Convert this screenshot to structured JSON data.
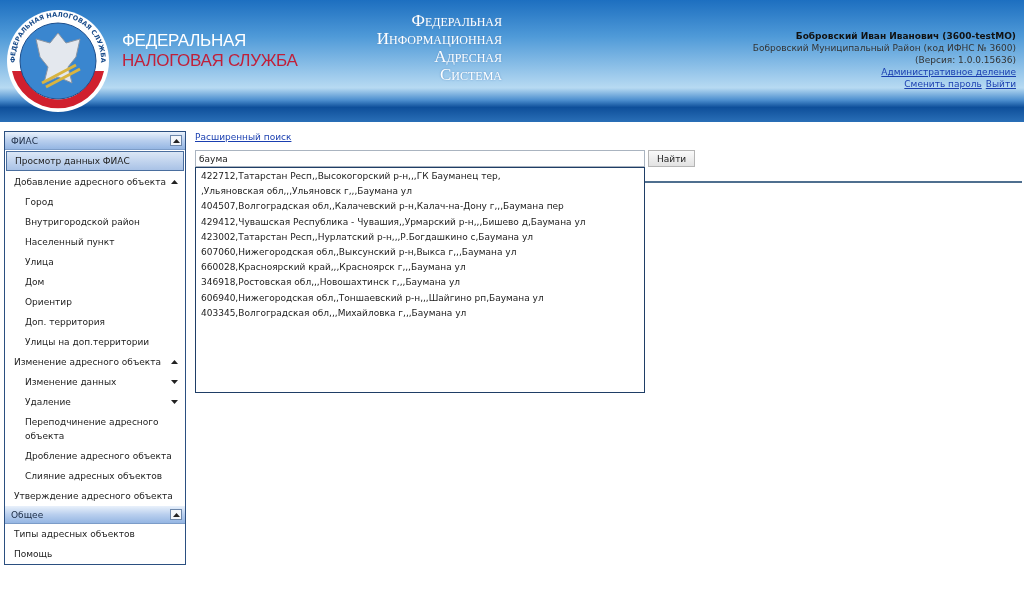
{
  "header": {
    "logo": {
      "ring_text": "ФЕДЕРАЛЬНАЯ НАЛОГОВАЯ СЛУЖБА"
    },
    "service_name": [
      "ФЕДЕРАЛЬНАЯ",
      "НАЛОГОВАЯ СЛУЖБА"
    ],
    "system_name": [
      "Федеральная",
      "Информационная",
      "Адресная",
      "Система"
    ],
    "user": {
      "name": "Бобровский Иван Иванович (3600-testMO)",
      "district": "Бобровский Муниципальный Район (код ИФНС № 3600)",
      "version": "(Версия: 1.0.0.15636)",
      "links": [
        [
          "Административное деление"
        ],
        [
          "Сменить пароль",
          "Выйти"
        ]
      ]
    }
  },
  "sidebar": {
    "sections": [
      {
        "title": "ФИАС",
        "expanded": true,
        "items": [
          {
            "label": "Просмотр данных ФИАС",
            "selected": true
          },
          {
            "label": "Добавление адресного объекта",
            "selected": false,
            "expanded": true,
            "children": [
              {
                "label": "Город",
                "selected": false
              },
              {
                "label": "Внутригородской район",
                "selected": false
              },
              {
                "label": "Населенный пункт",
                "selected": false
              },
              {
                "label": "Улица",
                "selected": false
              },
              {
                "label": "Дом",
                "selected": false
              },
              {
                "label": "Ориентир",
                "selected": false
              },
              {
                "label": "Доп. территория",
                "selected": false
              },
              {
                "label": "Улицы на доп.территории",
                "selected": false
              }
            ]
          },
          {
            "label": "Изменение адресного объекта",
            "selected": false,
            "expanded": true,
            "children": [
              {
                "label": "Изменение данных",
                "selected": false,
                "expanded": false
              },
              {
                "label": "Удаление",
                "selected": false,
                "expanded": false
              },
              {
                "label": "Переподчинение адресного объекта",
                "selected": false
              },
              {
                "label": "Дробление адресного объекта",
                "selected": false
              },
              {
                "label": "Слияние адресных объектов",
                "selected": false
              }
            ]
          },
          {
            "label": "Утверждение адресного объекта",
            "selected": false
          }
        ]
      },
      {
        "title": "Общее",
        "expanded": true,
        "items": [
          {
            "label": "Типы адресных объектов",
            "selected": false
          },
          {
            "label": "Помощь",
            "selected": false
          }
        ]
      }
    ]
  },
  "search": {
    "advanced_link": "Расширенный поиск",
    "value": "баума",
    "button": "Найти",
    "suggestions": [
      "422712,Татарстан Респ,,Высокогорский р-н,,,ГК Бауманец тер,",
      ",Ульяновская обл,,,Ульяновск г,,,Баумана ул",
      "404507,Волгоградская обл,,Калачевский р-н,Калач-на-Дону г,,,Баумана пер",
      "429412,Чувашская Республика - Чувашия,,Урмарский р-н,,,Бишево д,Баумана ул",
      "423002,Татарстан Респ,,Нурлатский р-н,,,Р.Богдашкино с,Баумана ул",
      "607060,Нижегородская обл,,Выксунский р-н,Выкса г,,,Баумана ул",
      "660028,Красноярский край,,,Красноярск г,,,Баумана ул",
      "346918,Ростовская обл,,,Новошахтинск г,,,Баумана ул",
      "606940,Нижегородская обл,,Тоншаевский р-н,,,Шайгино рп,Баумана ул",
      "403345,Волгоградская обл,,,Михайловка г,,,Баумана ул"
    ]
  }
}
